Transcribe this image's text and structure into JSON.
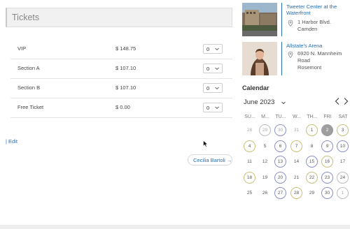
{
  "tickets": {
    "title": "Tickets",
    "rows": [
      {
        "name": "VIP",
        "price": "$ 148.75",
        "qty": "0"
      },
      {
        "name": "Section A",
        "price": "$ 107.10",
        "qty": "0"
      },
      {
        "name": "Section B",
        "price": "$ 107.10",
        "qty": "0"
      },
      {
        "name": "Free Ticket",
        "price": "$ 0.00",
        "qty": "0"
      }
    ],
    "edit_label": "| Edit",
    "user_link": "Cecilia Bartoli →"
  },
  "venues": [
    {
      "name_line1": "Tweeter Center at the",
      "name_line2": "Waterfront",
      "addr_line1": "1 Harbor Blvd.",
      "addr_line2": "Camden",
      "addr_line3": ""
    },
    {
      "name_line1": "Allstate's Arena",
      "name_line2": "",
      "addr_line1": "6920 N. Mannheim",
      "addr_line2": "Road",
      "addr_line3": "Rosemont"
    }
  ],
  "calendar": {
    "title": "Calendar",
    "month": "June 2023",
    "weekdays": [
      "SU...",
      "M...",
      "TU...",
      "W...",
      "TH...",
      "FRI",
      "SAT"
    ],
    "weeks": [
      [
        "28",
        "29",
        "30",
        "31",
        "1",
        "2",
        "3"
      ],
      [
        "4",
        "5",
        "6",
        "7",
        "8",
        "9",
        "10"
      ],
      [
        "11",
        "12",
        "13",
        "14",
        "15",
        "16",
        "17"
      ],
      [
        "18",
        "19",
        "20",
        "21",
        "22",
        "23",
        "24"
      ],
      [
        "25",
        "26",
        "27",
        "28",
        "29",
        "30",
        "1"
      ]
    ]
  }
}
